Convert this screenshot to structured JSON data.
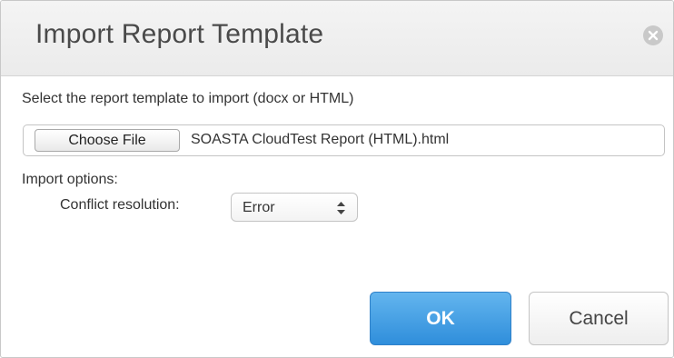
{
  "dialog": {
    "title": "Import Report Template",
    "close_icon": "close-circle-icon"
  },
  "file_picker": {
    "instruction": "Select the report template to import (docx or HTML)",
    "button_label": "Choose File",
    "file_name": "SOASTA CloudTest Report (HTML).html"
  },
  "options": {
    "heading": "Import options:",
    "conflict_label": "Conflict resolution:",
    "conflict_value": "Error",
    "select_icon": "select-arrows-icon"
  },
  "buttons": {
    "ok_label": "OK",
    "cancel_label": "Cancel"
  },
  "colors": {
    "ok_button": "#3d9de3",
    "titlebar": "#efefef",
    "close_icon": "#c9c9c9"
  }
}
